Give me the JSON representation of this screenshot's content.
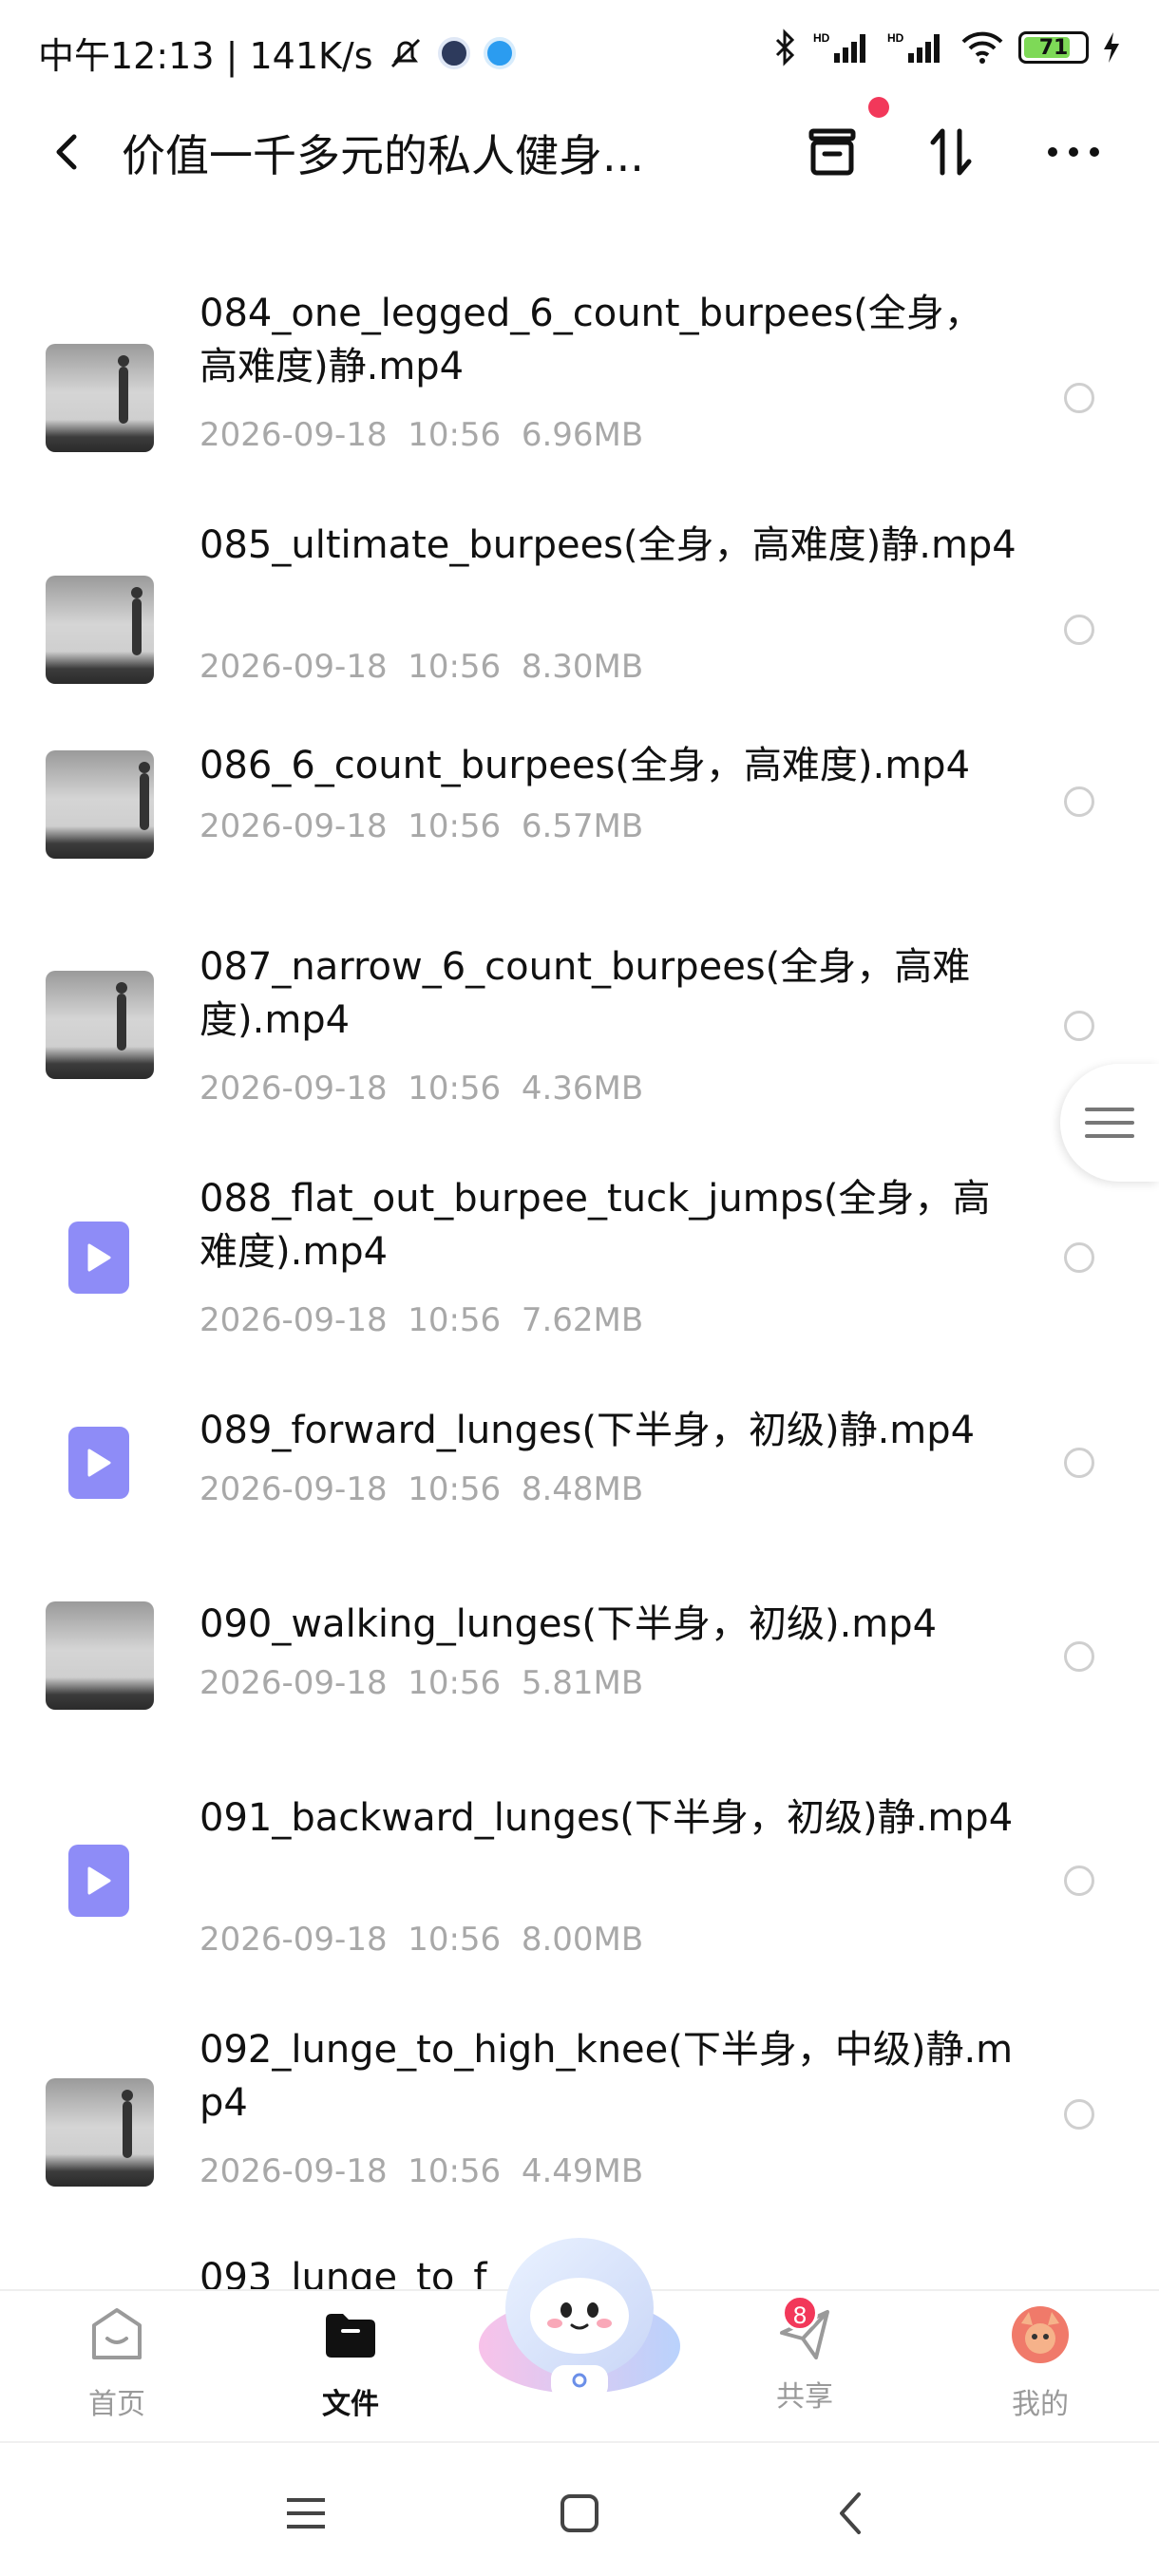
{
  "status_bar": {
    "time_speed": "中午12:13 | 141K/s",
    "battery": "71"
  },
  "header": {
    "title": "价值一千多元的私人健身..."
  },
  "files": [
    {
      "name": "084_one_legged_6_count_burpees(全身，高难度)静.mp4",
      "date": "2026-09-18  10:56",
      "size": "6.96MB",
      "thumb": "image"
    },
    {
      "name": "085_ultimate_burpees(全身，高难度)静.mp4",
      "date": "2026-09-18  10:56",
      "size": "8.30MB",
      "thumb": "image"
    },
    {
      "name": "086_6_count_burpees(全身，高难度).mp4",
      "date": "2026-09-18  10:56",
      "size": "6.57MB",
      "thumb": "image"
    },
    {
      "name": "087_narrow_6_count_burpees(全身，高难度).mp4",
      "date": "2026-09-18  10:56",
      "size": "4.36MB",
      "thumb": "image"
    },
    {
      "name": "088_flat_out_burpee_tuck_jumps(全身，高难度).mp4",
      "date": "2026-09-18  10:56",
      "size": "7.62MB",
      "thumb": "video-icon"
    },
    {
      "name": "089_forward_lunges(下半身，初级)静.mp4",
      "date": "2026-09-18  10:56",
      "size": "8.48MB",
      "thumb": "video-icon"
    },
    {
      "name": "090_walking_lunges(下半身，初级).mp4",
      "date": "2026-09-18  10:56",
      "size": "5.81MB",
      "thumb": "image"
    },
    {
      "name": "091_backward_lunges(下半身，初级)静.mp4",
      "date": "2026-09-18  10:56",
      "size": "8.00MB",
      "thumb": "video-icon"
    },
    {
      "name": "092_lunge_to_high_knee(下半身，中级)静.mp4",
      "date": "2026-09-18  10:56",
      "size": "4.49MB",
      "thumb": "image"
    }
  ],
  "partial_file": {
    "name": "093_lunge_to_f"
  },
  "bottom_nav": {
    "home": "首页",
    "files": "文件",
    "share": "共享",
    "share_badge": "8",
    "mine": "我的"
  },
  "colors": {
    "accent_video": "#8e8cf7",
    "badge": "#f2385a",
    "meta_text": "#a8a8a8"
  }
}
